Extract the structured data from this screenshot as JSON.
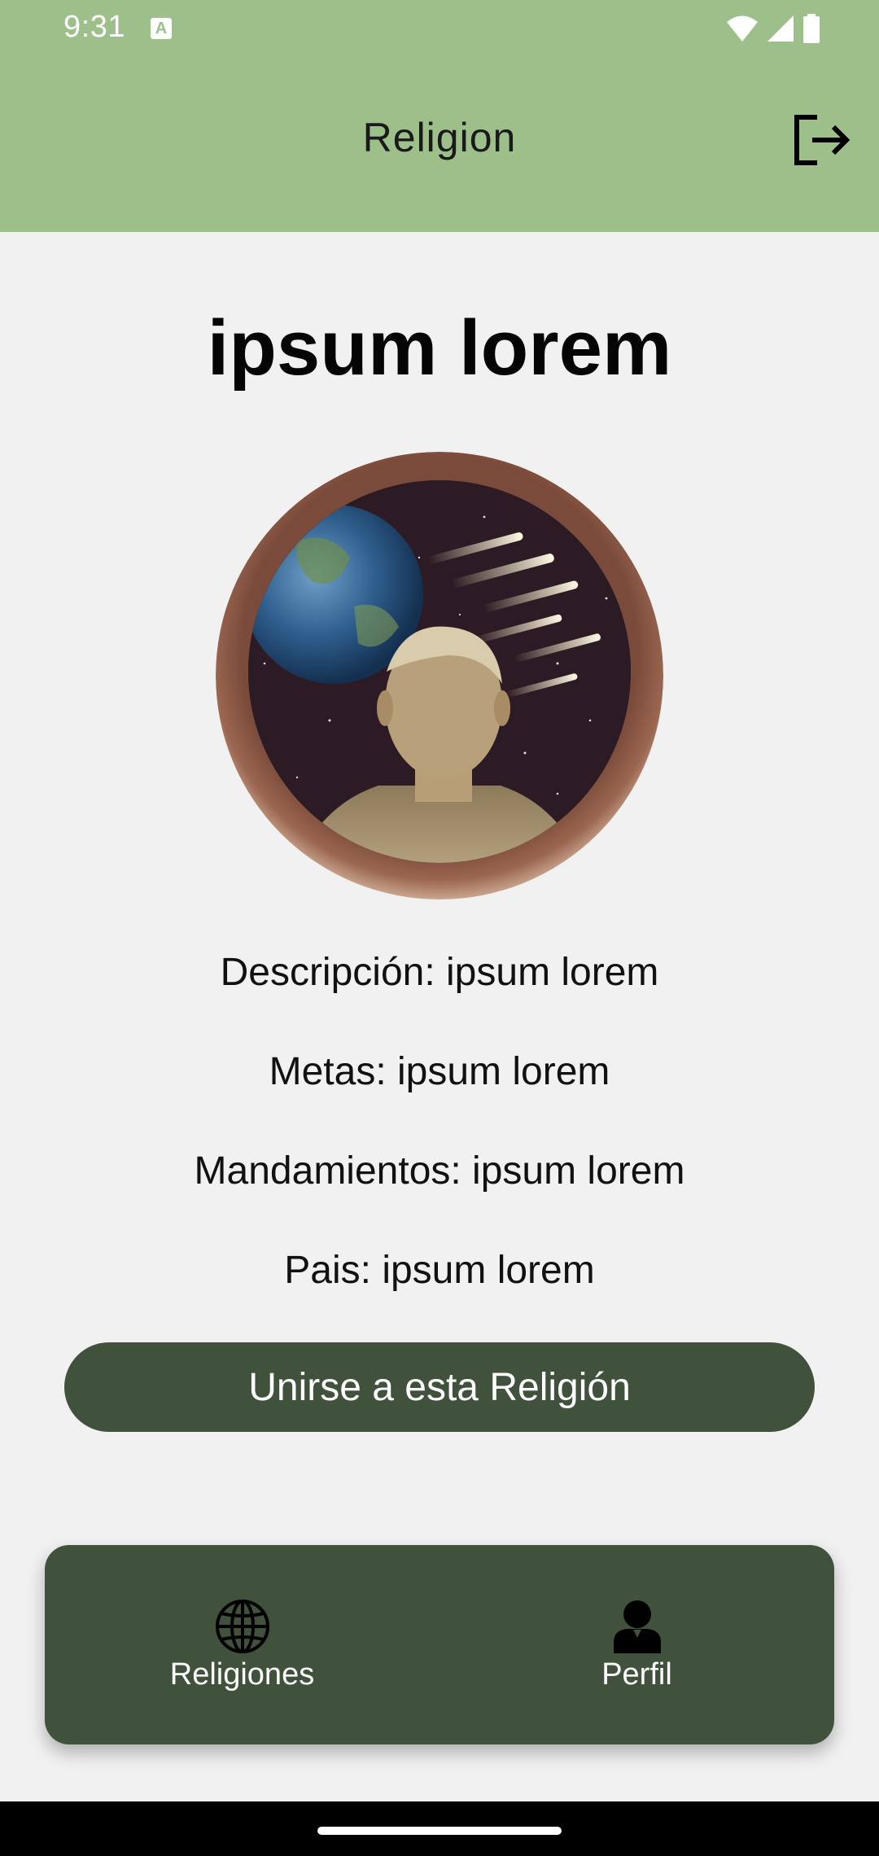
{
  "status_bar": {
    "time": "9:31",
    "notification_icon": "a-icon",
    "icons": [
      "wifi-icon",
      "signal-icon",
      "battery-icon"
    ]
  },
  "app_bar": {
    "title": "Religion",
    "logout_icon": "logout-icon"
  },
  "religion": {
    "title": "ipsum lorem",
    "image_icon": "religion-image",
    "details": [
      "Descripción: ipsum lorem",
      "Metas: ipsum lorem",
      "Mandamientos: ipsum lorem",
      "Pais: ipsum lorem"
    ],
    "join_label": "Unirse a esta Religión"
  },
  "bottom_nav": {
    "items": [
      {
        "label": "Religiones",
        "icon": "globe-icon"
      },
      {
        "label": "Perfil",
        "icon": "person-icon"
      }
    ]
  },
  "colors": {
    "app_bar": "#9dc08b",
    "background": "#f2f1f2",
    "primary_dark": "#40523c",
    "system_nav": "#000000"
  }
}
